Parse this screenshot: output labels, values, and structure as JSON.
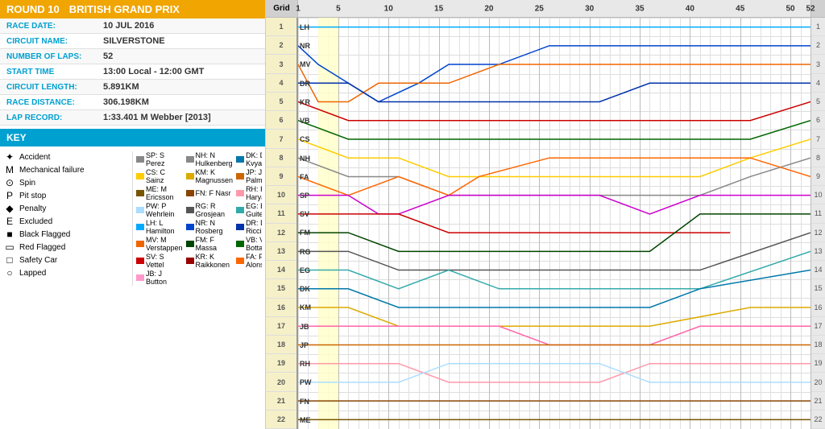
{
  "header": {
    "round_label": "ROUND 10",
    "race_name": "BRITISH GRAND PRIX"
  },
  "race_info": [
    {
      "label": "RACE DATE:",
      "value": "10 JUL 2016"
    },
    {
      "label": "CIRCUIT NAME:",
      "value": "SILVERSTONE"
    },
    {
      "label": "NUMBER OF LAPS:",
      "value": "52"
    },
    {
      "label": "START TIME",
      "value": "13:00 Local - 12:00 GMT"
    },
    {
      "label": "CIRCUIT LENGTH:",
      "value": "5.891KM"
    },
    {
      "label": "RACE DISTANCE:",
      "value": "306.198KM"
    },
    {
      "label": "LAP RECORD:",
      "value": "1:33.401 M Webber [2013]"
    }
  ],
  "key_label": "KEY",
  "key_items": [
    {
      "symbol": "✦",
      "label": "Accident"
    },
    {
      "symbol": "M",
      "label": "Mechanical failure"
    },
    {
      "symbol": "⊙",
      "label": "Spin"
    },
    {
      "symbol": "P",
      "label": "Pit stop"
    },
    {
      "symbol": "◆",
      "label": "Penalty"
    },
    {
      "symbol": "E",
      "label": "Excluded"
    },
    {
      "symbol": "■",
      "label": "Black Flagged"
    },
    {
      "symbol": "▭",
      "label": "Red Flagged"
    },
    {
      "symbol": "□",
      "label": "Safety Car"
    },
    {
      "symbol": "○",
      "label": "Lapped"
    }
  ],
  "drivers": [
    {
      "code": "LH",
      "name": "L Hamilton",
      "color": "#00aaff",
      "grid": 1
    },
    {
      "code": "NR",
      "name": "N Rosberg",
      "color": "#0044cc",
      "grid": 2
    },
    {
      "code": "MV",
      "name": "M Verstappen",
      "color": "#ee6600",
      "grid": 3
    },
    {
      "code": "DR",
      "name": "D Ricciardo",
      "color": "#0033aa",
      "grid": 4
    },
    {
      "code": "KR",
      "name": "K Raikkonen",
      "color": "#cc0000",
      "grid": 5
    },
    {
      "code": "VB",
      "name": "V Bottas",
      "color": "#006600",
      "grid": 6
    },
    {
      "code": "CS",
      "name": "C Sainz",
      "color": "#ffcc00",
      "grid": 7
    },
    {
      "code": "NH",
      "name": "N Hulkenberg",
      "color": "#888888",
      "grid": 8
    },
    {
      "code": "FA",
      "name": "F Alonso",
      "color": "#ff6600",
      "grid": 9
    },
    {
      "code": "SP",
      "name": "S Perez",
      "color": "#cc00cc",
      "grid": 10
    },
    {
      "code": "SV",
      "name": "S Vettel",
      "color": "#cc0000",
      "grid": 11
    },
    {
      "code": "FM",
      "name": "F Massa",
      "color": "#004400",
      "grid": 12
    },
    {
      "code": "RG",
      "name": "R Grosjean",
      "color": "#555555",
      "grid": 13
    },
    {
      "code": "EG",
      "name": "E Guiterrez",
      "color": "#33aaaa",
      "grid": 14
    },
    {
      "code": "DK",
      "name": "D Kvyat",
      "color": "#0077aa",
      "grid": 15
    },
    {
      "code": "KM",
      "name": "K Magnussen",
      "color": "#ddaa00",
      "grid": 16
    },
    {
      "code": "JB",
      "name": "J Button",
      "color": "#ff99cc",
      "grid": 17
    },
    {
      "code": "JP",
      "name": "J Palmer",
      "color": "#cc6600",
      "grid": 18
    },
    {
      "code": "RH",
      "name": "R Haryanto",
      "color": "#ff99aa",
      "grid": 19
    },
    {
      "code": "PW",
      "name": "P Wehrlein",
      "color": "#aaddff",
      "grid": 20
    },
    {
      "code": "FN",
      "name": "F Nasr",
      "color": "#884400",
      "grid": 21
    },
    {
      "code": "ME",
      "name": "M Ericsson",
      "color": "#775500",
      "grid": 22
    }
  ],
  "chart": {
    "total_laps": 52,
    "lap_markers": [
      1,
      5,
      10,
      15,
      20,
      25,
      30,
      35,
      40,
      45,
      50,
      52
    ]
  }
}
